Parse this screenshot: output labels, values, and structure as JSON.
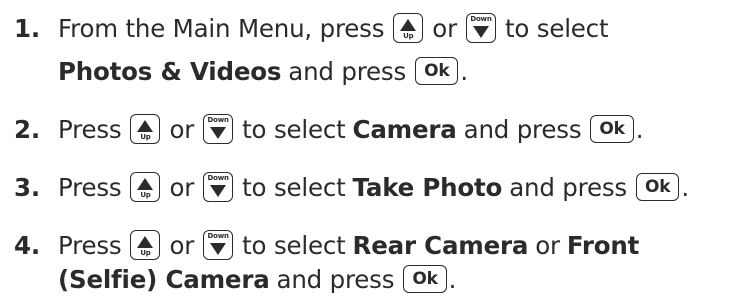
{
  "keys": {
    "up_caption": "Up",
    "down_caption": "Down",
    "ok_label": "Ok"
  },
  "steps": [
    {
      "number": "1.",
      "line1_a": "From the Main Menu, press",
      "line1_or": "or",
      "line1_b": "to select",
      "line2_bold": "Photos & Videos",
      "line2_after": "and press",
      "line2_end": "."
    },
    {
      "number": "2.",
      "press": "Press",
      "or": "or",
      "mid": "to select",
      "bold": "Camera",
      "after": "and press",
      "end": "."
    },
    {
      "number": "3.",
      "press": "Press",
      "or": "or",
      "mid": "to select",
      "bold": "Take Photo",
      "after": "and press",
      "end": "."
    },
    {
      "number": "4.",
      "press": "Press",
      "or": "or",
      "mid": "to select",
      "bold": "Rear Camera",
      "or2": "or",
      "bold2": "Front",
      "line2_bold": "(Selfie) Camera",
      "line2_after": "and press",
      "line2_end": "."
    }
  ]
}
